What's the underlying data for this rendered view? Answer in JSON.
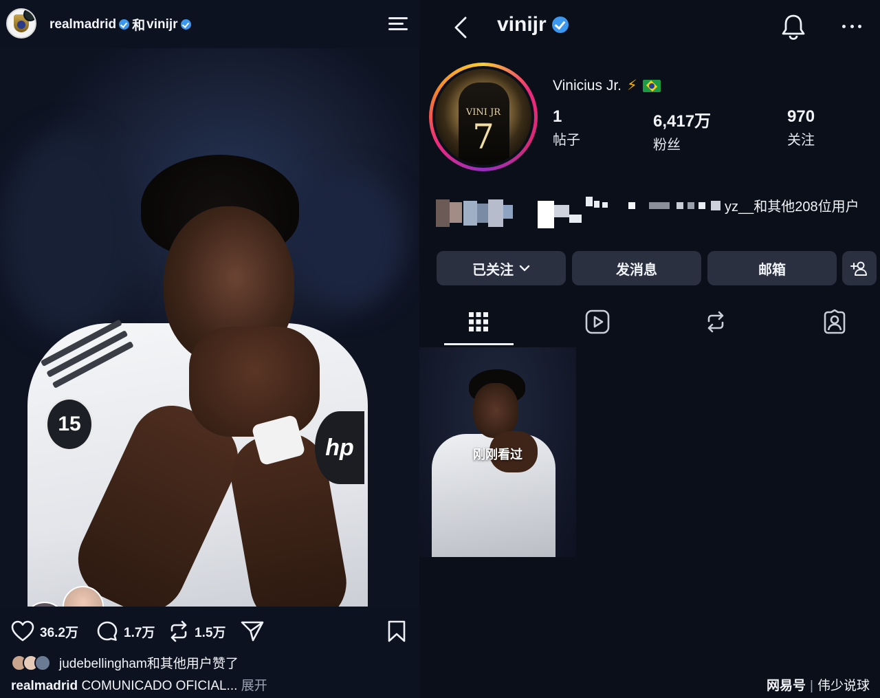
{
  "left": {
    "header": {
      "account_a": "realmadrid",
      "joiner": "和",
      "account_b": "vinijr"
    },
    "actions": {
      "likes": "36.2万",
      "comments": "1.7万",
      "reposts": "1.5万"
    },
    "liked_by": "judebellingham和其他用户赞了",
    "caption": {
      "user": "realmadrid",
      "text": "COMUNICADO OFICIAL...",
      "more": "展开"
    },
    "photo": {
      "badge_number": "15",
      "sponsor": "hp"
    }
  },
  "right": {
    "header": {
      "username": "vinijr"
    },
    "profile": {
      "display_name": "Vinicius Jr.",
      "emoji": "⚡",
      "avatar_text_top": "VINI JR",
      "avatar_text_number": "7",
      "stats": [
        {
          "value": "1",
          "label": "帖子"
        },
        {
          "value": "6,417万",
          "label": "粉丝"
        },
        {
          "value": "970",
          "label": "关注"
        }
      ],
      "followed_by": "yz__和其他208位用户"
    },
    "buttons": {
      "following": "已关注",
      "message": "发消息",
      "email": "邮箱"
    },
    "grid": {
      "post_label": "刚刚看过"
    }
  },
  "watermark": {
    "source": "网易号",
    "author": "伟少说球"
  },
  "colors": {
    "background": "#0b0f1a",
    "verified": "#3b97f0",
    "button": "#2a3040",
    "heart": "#ff3b5c"
  },
  "icons": [
    "menu-icon",
    "back-icon",
    "bell-icon",
    "more-icon",
    "heart-icon",
    "comment-icon",
    "repost-icon",
    "send-icon",
    "bookmark-icon",
    "grid-icon",
    "reels-icon",
    "repost-tab-icon",
    "tagged-icon",
    "add-person-icon",
    "chevron-down-icon"
  ]
}
